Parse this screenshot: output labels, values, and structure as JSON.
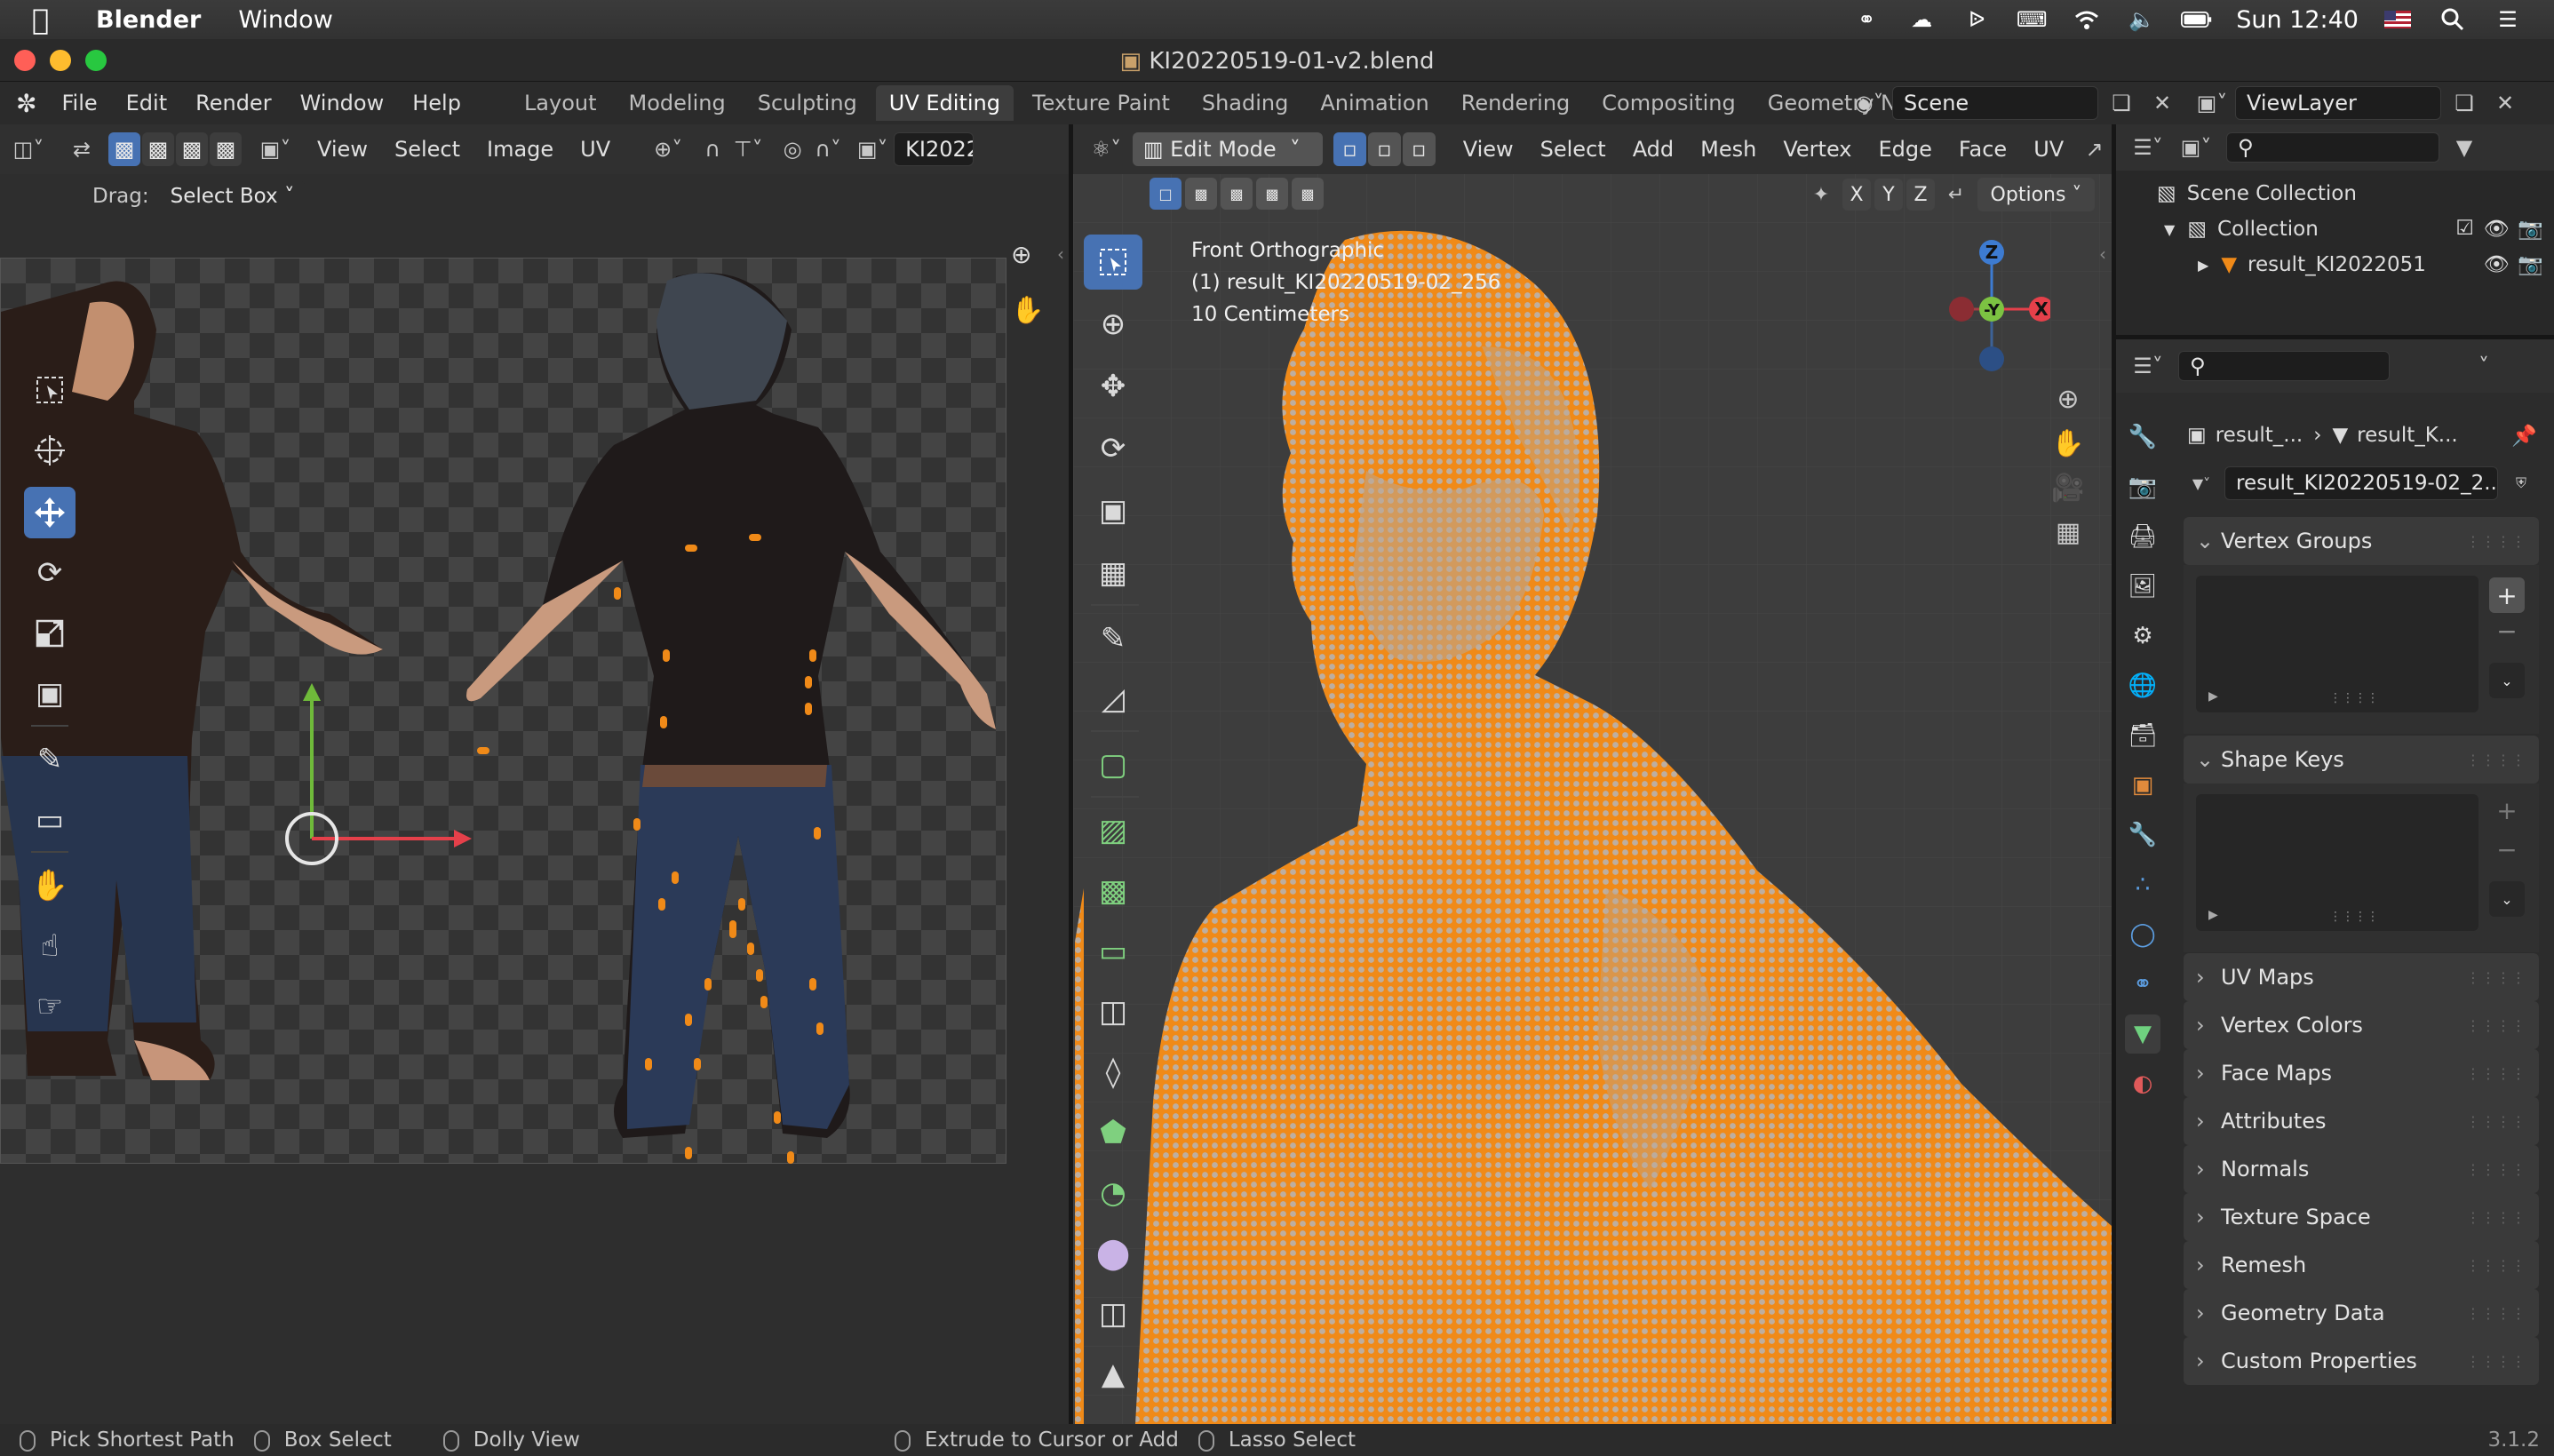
{
  "macbar": {
    "app": "Blender",
    "menus": [
      "Window"
    ],
    "clock": "Sun 12:40"
  },
  "window": {
    "title": "KI20220519-01-v2.blend"
  },
  "topbar": {
    "menus": [
      "File",
      "Edit",
      "Render",
      "Window",
      "Help"
    ],
    "workspaces": [
      "Layout",
      "Modeling",
      "Sculpting",
      "UV Editing",
      "Texture Paint",
      "Shading",
      "Animation",
      "Rendering",
      "Compositing",
      "Geometry Nodes"
    ],
    "active_workspace": "UV Editing",
    "scene": "Scene",
    "view_layer": "ViewLayer"
  },
  "uv_editor": {
    "menus": [
      "View",
      "Select",
      "Image",
      "UV"
    ],
    "image_name": "KI2022",
    "drag_label": "Drag:",
    "drag_value": "Select Box"
  },
  "viewport": {
    "mode": "Edit Mode",
    "menus": [
      "View",
      "Select",
      "Add",
      "Mesh",
      "Vertex",
      "Edge",
      "Face",
      "UV"
    ],
    "axes_lock": [
      "X",
      "Y",
      "Z"
    ],
    "options_label": "Options",
    "overlay_view": "Front Orthographic",
    "overlay_object": "(1) result_KI20220519-02_256",
    "overlay_scale": "10 Centimeters",
    "gizmo": {
      "z": "Z",
      "y": "-Y",
      "x": "X"
    }
  },
  "outliner": {
    "scene_collection": "Scene Collection",
    "collection": "Collection",
    "object": "result_KI2022051"
  },
  "properties": {
    "breadcrumb_obj": "result_...",
    "breadcrumb_mesh": "result_K...",
    "mesh_name": "result_KI20220519-02_2...",
    "vertex_groups": "Vertex Groups",
    "shape_keys": "Shape Keys",
    "collapsed_panels": [
      "UV Maps",
      "Vertex Colors",
      "Face Maps",
      "Attributes",
      "Normals",
      "Texture Space",
      "Remesh",
      "Geometry Data",
      "Custom Properties"
    ]
  },
  "statusbar": {
    "items": [
      "Pick Shortest Path",
      "Box Select",
      "Dolly View",
      "Extrude to Cursor or Add",
      "Lasso Select"
    ],
    "version": "3.1.2"
  },
  "colors": {
    "accent": "#4772b3",
    "mesh_orange": "#f08a18",
    "header": "#303030",
    "bg": "#1d1d1d"
  }
}
